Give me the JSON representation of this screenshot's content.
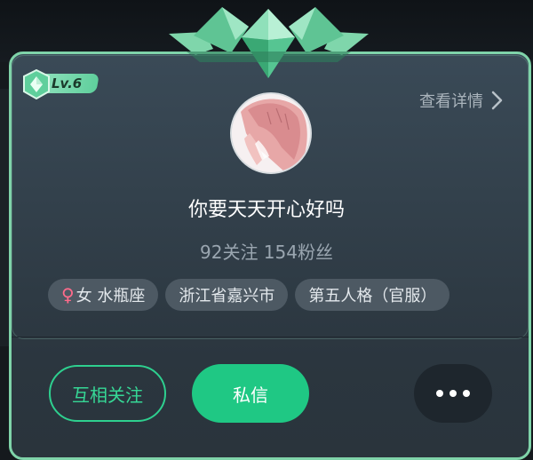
{
  "profile": {
    "level": "Lv.6",
    "detail_link": "查看详情",
    "nickname": "你要天天开心好吗",
    "follow_stats": "92关注 154粉丝",
    "tags": [
      {
        "gender_symbol": "♀",
        "label": "女 水瓶座"
      },
      {
        "label": "浙江省嘉兴市"
      },
      {
        "label": "第五人格（官服）"
      }
    ]
  },
  "actions": {
    "follow": "互相关注",
    "message": "私信"
  },
  "colors": {
    "accent_green": "#1fc884",
    "border_green": "#7fd3a9",
    "female_pink": "#ff6b8b"
  },
  "icons": {
    "level_badge": "diamond-shield-icon",
    "detail": "chevron-right-icon",
    "more": "more-dots-icon",
    "crown": "crown-ornament"
  }
}
